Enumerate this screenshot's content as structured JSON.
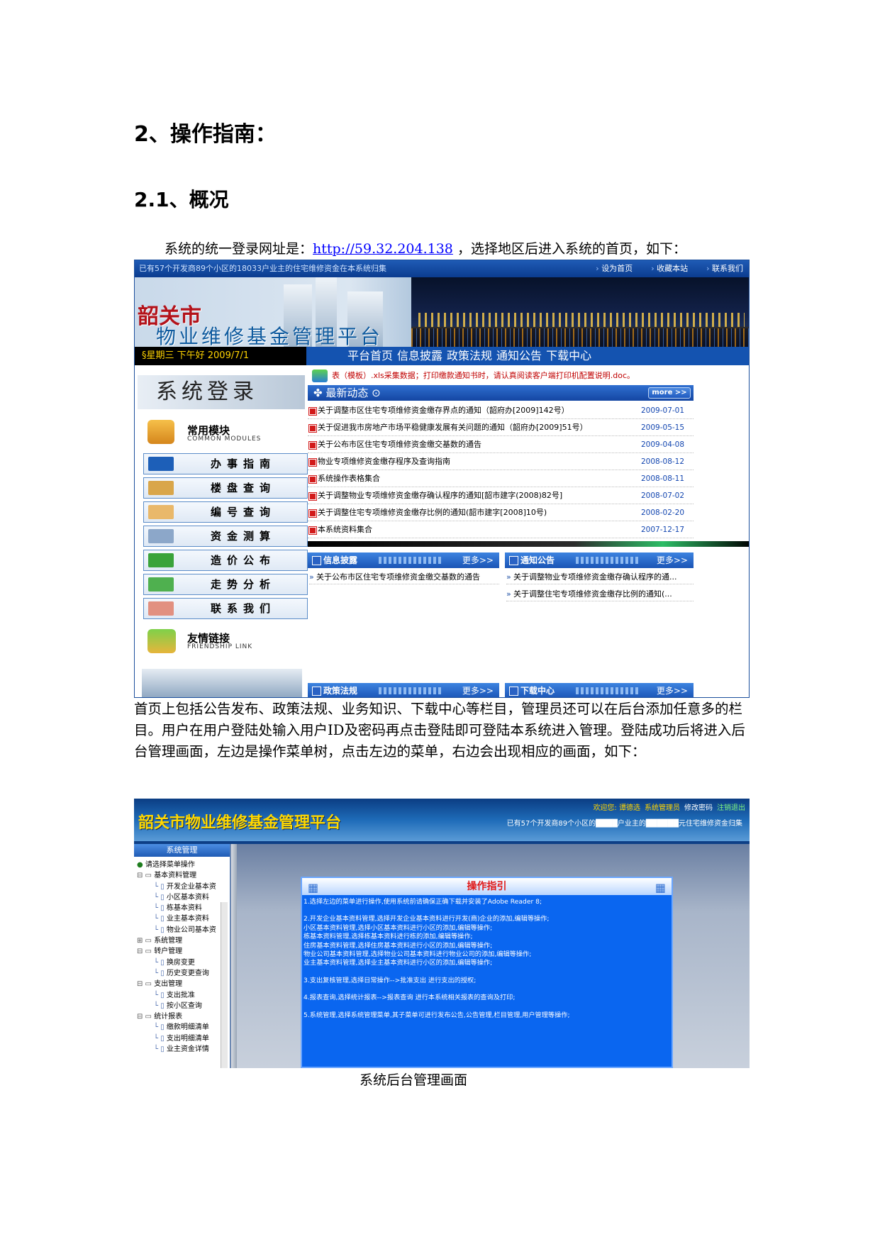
{
  "heading1": "2、操作指南：",
  "heading2": "2.1、概况",
  "intro": {
    "before": "系统的统一登录网址是：",
    "url": "http://59.32.204.138",
    "after": " ，选择地区后进入系统的首页，如下："
  },
  "shot1": {
    "stat": "已有57个开发商89个小区的18033户业主的住宅维修资金在本系统归集",
    "top_links": [
      "设为首页",
      "收藏本站",
      "联系我们"
    ],
    "banner_title1": "韶关市",
    "banner_title2": "物业维修基金管理平台",
    "date": "§星期三 下午好   2009/7/1",
    "nav": [
      "平台首页",
      "信息披露",
      "政策法规",
      "通知公告",
      "下载中心"
    ],
    "login_title": "系统登录",
    "modules_cn": "常用模块",
    "modules_en": "COMMON MODULES",
    "menu": [
      "办事指南",
      "楼盘查询",
      "编号查询",
      "资金测算",
      "造价公布",
      "走势分析",
      "联系我们"
    ],
    "friend_cn": "友情链接",
    "friend_en": "FRIENDSHIP LINK",
    "notice": "表（模板）.xls采集数据；打印缴款通知书时，请认真阅读客户端打印机配置说明.doc。",
    "news_title": "最新动态",
    "more": "more >>",
    "news": [
      {
        "title": "关于调整市区住宅专项维修资金缴存界点的通知（韶府办[2009]142号）",
        "date": "2009-07-01"
      },
      {
        "title": "关于促进我市房地产市场平稳健康发展有关问题的通知（韶府办[2009]51号）",
        "date": "2009-05-15"
      },
      {
        "title": "关于公布市区住宅专项维修资金缴交基数的通告",
        "date": "2009-04-08"
      },
      {
        "title": "物业专项维修资金缴存程序及查询指南",
        "date": "2008-08-12"
      },
      {
        "title": "系统操作表格集合",
        "date": "2008-08-11"
      },
      {
        "title": "关于调整物业专项维修资金缴存确认程序的通知[韶市建字(2008)82号]",
        "date": "2008-07-02"
      },
      {
        "title": "关于调整住宅专项维修资金缴存比例的通知(韶市建字[2008]10号)",
        "date": "2008-02-20"
      },
      {
        "title": "本系统资料集合",
        "date": "2007-12-17"
      }
    ],
    "panel_more": "更多>>",
    "panels": {
      "info": "信息披露",
      "notice": "通知公告",
      "policy": "政策法规",
      "download": "下载中心"
    },
    "info_items": [
      "关于公布市区住宅专项维修资金缴交基数的通告"
    ],
    "notice_items": [
      "关于调整物业专项维修资金缴存确认程序的通...",
      "关于调整住宅专项维修资金缴存比例的通知(..."
    ]
  },
  "body_text": "首页上包括公告发布、政策法规、业务知识、下载中心等栏目，管理员还可以在后台添加任意多的栏目。用户在用户登陆处输入用户ID及密码再点击登陆即可登陆本系统进入管理。登陆成功后将进入后台管理画面，左边是操作菜单树，点击左边的菜单，右边会出现相应的画面，如下：",
  "shot2": {
    "title": "韶关市物业维修基金管理平台",
    "welcome": "欢迎您: 谭德选",
    "role": "系统管理员",
    "change_pwd": "修改密码",
    "logout": "注销退出",
    "stat": "已有57个开发商89个小区的████户业主的██████元住宅维修资金归集",
    "side_header": "系统管理",
    "tree": [
      {
        "type": "root",
        "label": "请选择菜单操作"
      },
      {
        "type": "grp",
        "label": "基本资料管理"
      },
      {
        "type": "leaf",
        "label": "开发企业基本资"
      },
      {
        "type": "leaf",
        "label": "小区基本资料"
      },
      {
        "type": "leaf",
        "label": "栋基本资料"
      },
      {
        "type": "leaf",
        "label": "业主基本资料"
      },
      {
        "type": "leaf",
        "label": "物业公司基本资"
      },
      {
        "type": "grpc",
        "label": "系统管理"
      },
      {
        "type": "grp",
        "label": "转户管理"
      },
      {
        "type": "leaf",
        "label": "换房变更"
      },
      {
        "type": "leaf",
        "label": "历史变更查询"
      },
      {
        "type": "grp",
        "label": "支出管理"
      },
      {
        "type": "leaf",
        "label": "支出批准"
      },
      {
        "type": "leaf",
        "label": "按小区查询"
      },
      {
        "type": "grp",
        "label": "统计报表"
      },
      {
        "type": "leaf",
        "label": "缴款明细清单"
      },
      {
        "type": "leaf",
        "label": "支出明细清单"
      },
      {
        "type": "leaf",
        "label": "业主资金详情"
      }
    ],
    "guide_title": "操作指引",
    "guide": [
      [
        "1.选择左边的菜单进行操作,使用系统前请确保正确下载并安装了Adobe Reader 8;"
      ],
      [
        "2.开发企业基本资料管理,选择开发企业基本资料进行开发(商)企业的添加,编辑等操作;",
        " 小区基本资料管理,选择小区基本资料进行小区的添加,编辑等操作;",
        " 栋基本资料管理,选择栋基本资料进行栋的添加,编辑等操作;",
        " 住房基本资料管理,选择住房基本资料进行小区的添加,编辑等操作;",
        " 物业公司基本资料管理,选择物业公司基本资料进行物业公司的添加,编辑等操作;",
        " 业主基本资料管理,选择业主基本资料进行小区的添加,编辑等操作;"
      ],
      [
        "3.支出复核管理,选择日常操作-->批准支出 进行支出的授权;"
      ],
      [
        "4.报表查询,选择统计报表-->报表查询 进行本系统相关报表的查询及打印;"
      ],
      [
        "5.系统管理,选择系统管理菜单,其子菜单可进行发布公告,公告管理,栏目管理,用户管理等操作;"
      ]
    ]
  },
  "caption": "系统后台管理画面"
}
